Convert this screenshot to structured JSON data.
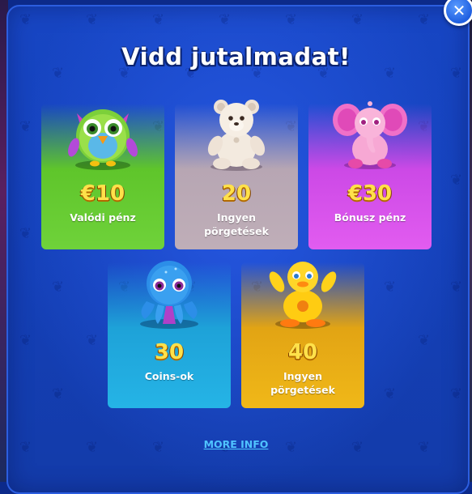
{
  "dialog": {
    "title": "Vidd jutalmadat!",
    "close_symbol": "✕",
    "more_info_label": "MORE INFO"
  },
  "rewards": [
    {
      "value": "€10",
      "label": "Valódi pénz",
      "toy": "owl-toy-icon",
      "color": "#5ec42a"
    },
    {
      "value": "20",
      "label": "Ingyen pörgetések",
      "toy": "teddy-bear-toy-icon",
      "color": "#b8a8b4"
    },
    {
      "value": "€30",
      "label": "Bónusz pénz",
      "toy": "elephant-toy-icon",
      "color": "#d64fe6"
    },
    {
      "value": "30",
      "label": "Coins-ok",
      "toy": "octopus-toy-icon",
      "color": "#21a8dc"
    },
    {
      "value": "40",
      "label": "Ingyen pörgetések",
      "toy": "duck-toy-icon",
      "color": "#e9ad16"
    }
  ]
}
